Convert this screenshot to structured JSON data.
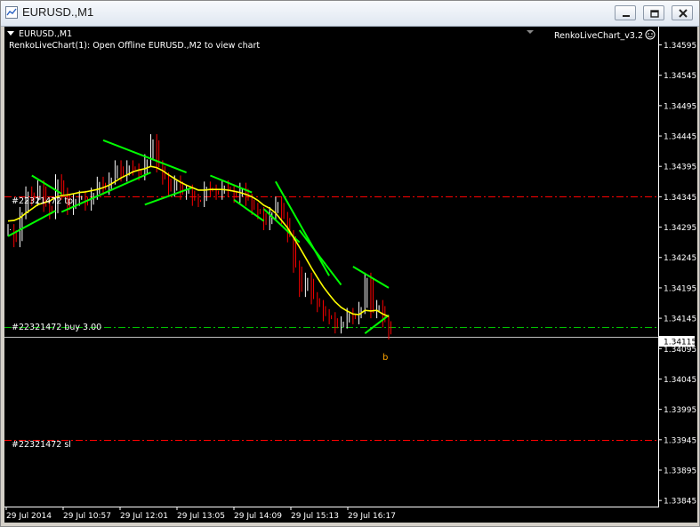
{
  "window": {
    "title": "EURUSD.,M1",
    "minimize_label": "minimize",
    "restore_label": "restore",
    "close_label": "close"
  },
  "chart": {
    "symbol_header": "EURUSD.,M1",
    "indicator_message": "RenkoLiveChart(1): Open Offline EURUSD.,M2 to view chart",
    "indicator_name": "RenkoLiveChart_v3.2",
    "current_price": "1.34115",
    "trade_marker": "b",
    "lines": {
      "order_top": "#22321472 tp",
      "order_buy": "#22321472 buy 3.00",
      "order_sl": "#22321472 sl"
    },
    "colors": {
      "background": "#000000",
      "bull_candle": "#ffffff",
      "bear_candle": "#ff0000",
      "ma_yellow": "#ffff00",
      "ma_green": "#00ff00",
      "tp_line": "#ff0000",
      "buy_line": "#00c000",
      "sl_line": "#ff0000",
      "axis_text": "#ffffff"
    }
  },
  "chart_data": {
    "type": "line",
    "title": "EURUSD.,M1",
    "ylim": [
      1.33835,
      1.34625
    ],
    "y_ticks": [
      "1.34595",
      "1.34545",
      "1.34495",
      "1.34445",
      "1.34395",
      "1.34345",
      "1.34295",
      "1.34245",
      "1.34195",
      "1.34145",
      "1.34095",
      "1.34045",
      "1.33995",
      "1.33945",
      "1.33895",
      "1.33845"
    ],
    "x_ticks": [
      "29 Jul 2014",
      "29 Jul 10:57",
      "29 Jul 12:01",
      "29 Jul 13:05",
      "29 Jul 14:09",
      "29 Jul 15:13",
      "29 Jul 16:17"
    ],
    "horizontal_lines": [
      {
        "name": "#22321472 tp",
        "value": 1.34345
      },
      {
        "name": "#22321472 buy 3.00",
        "value": 1.3413
      },
      {
        "name": "#22321472 sl",
        "value": 1.33945
      },
      {
        "name": "bid",
        "value": 1.34115
      }
    ],
    "price_path": [
      1.3429,
      1.34272,
      1.34318,
      1.34352,
      1.3434,
      1.34362,
      1.3433,
      1.34318,
      1.34372,
      1.3435,
      1.34325,
      1.3434,
      1.34345,
      1.34332,
      1.3435,
      1.34368,
      1.34358,
      1.34375,
      1.34395,
      1.3438,
      1.34395,
      1.3439,
      1.34382,
      1.34405,
      1.34438,
      1.34395,
      1.34375,
      1.34355,
      1.3437,
      1.3435,
      1.34355,
      1.3434,
      1.34338,
      1.3436,
      1.34355,
      1.3435,
      1.34362,
      1.34355,
      1.34345,
      1.34358,
      1.3434,
      1.34325,
      1.34318,
      1.343,
      1.34318,
      1.34335,
      1.3431,
      1.3428,
      1.3423,
      1.3419,
      1.3421,
      1.34178,
      1.34165,
      1.3415,
      1.34145,
      1.3413,
      1.34138,
      1.34152,
      1.34145,
      1.34162,
      1.3421,
      1.34155,
      1.34165,
      1.3414,
      1.3412
    ],
    "ma_yellow": [
      1.34305,
      1.34306,
      1.3431,
      1.34318,
      1.34325,
      1.34332,
      1.34335,
      1.34338,
      1.34344,
      1.34347,
      1.34348,
      1.3435,
      1.34352,
      1.34353,
      1.34355,
      1.34357,
      1.3436,
      1.34364,
      1.3437,
      1.34376,
      1.34381,
      1.34386,
      1.34389,
      1.34391,
      1.34395,
      1.34393,
      1.34388,
      1.34381,
      1.34375,
      1.34369,
      1.34364,
      1.3436,
      1.34356,
      1.34356,
      1.34357,
      1.34357,
      1.34357,
      1.34356,
      1.34354,
      1.34352,
      1.34349,
      1.34345,
      1.34339,
      1.34331,
      1.34326,
      1.34318,
      1.34306,
      1.34294,
      1.34278,
      1.34262,
      1.34245,
      1.34228,
      1.34212,
      1.34197,
      1.34184,
      1.34172,
      1.34163,
      1.34157,
      1.34152,
      1.34151,
      1.34158,
      1.34157,
      1.34158,
      1.34152,
      1.34148
    ],
    "ma_green_segments": [
      [
        [
          0,
          1.3428
        ],
        [
          8,
          1.34322
        ]
      ],
      [
        [
          4,
          1.3438
        ],
        [
          9,
          1.3435
        ]
      ],
      [
        [
          9,
          1.3432
        ],
        [
          24,
          1.34385
        ]
      ],
      [
        [
          16,
          1.34438
        ],
        [
          30,
          1.34385
        ]
      ],
      [
        [
          23,
          1.34332
        ],
        [
          31,
          1.3436
        ]
      ],
      [
        [
          34,
          1.3438
        ],
        [
          41,
          1.34352
        ]
      ],
      [
        [
          38,
          1.3434
        ],
        [
          43,
          1.34305
        ]
      ],
      [
        [
          43,
          1.34325
        ],
        [
          49,
          1.3427
        ]
      ],
      [
        [
          45,
          1.3437
        ],
        [
          54,
          1.34215
        ]
      ],
      [
        [
          49,
          1.3429
        ],
        [
          56,
          1.342
        ]
      ],
      [
        [
          60,
          1.3412
        ],
        [
          64,
          1.3415
        ]
      ],
      [
        [
          58,
          1.3423
        ],
        [
          64,
          1.34195
        ]
      ]
    ]
  }
}
